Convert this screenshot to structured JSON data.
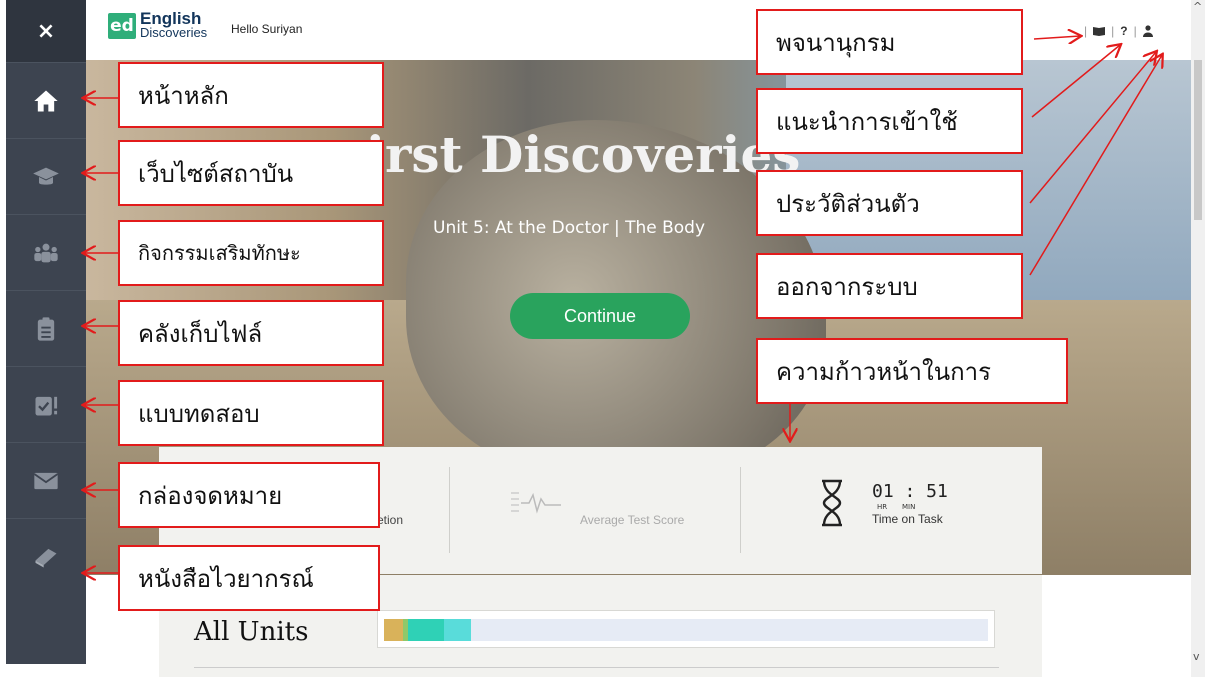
{
  "sidebar": {
    "close": "×",
    "items": [
      {
        "icon": "home-icon"
      },
      {
        "icon": "graduation-cap-icon"
      },
      {
        "icon": "users-icon"
      },
      {
        "icon": "clipboard-icon"
      },
      {
        "icon": "test-check-icon"
      },
      {
        "icon": "envelope-icon"
      },
      {
        "icon": "book-icon"
      }
    ]
  },
  "header": {
    "logo_badge": "ed",
    "logo_line1": "English",
    "logo_line2": "Discoveries",
    "greeting": "Hello Suriyan",
    "icons": [
      "dictionary-icon",
      "help-icon",
      "user-icon"
    ],
    "help_label": "?"
  },
  "hero": {
    "title": "irst Discoveries",
    "subtitle": "Unit 5: At the Doctor | The Body",
    "continue_label": "Continue"
  },
  "stats": {
    "completion_label": "etion",
    "average_test_score_label": "Average Test Score",
    "time_value": "01 : 51",
    "time_hr": "HR",
    "time_min": "MIN",
    "time_label": "Time on Task"
  },
  "units": {
    "title": "All Units",
    "progress_segments": [
      {
        "color": "#d9b25a",
        "fraction": 0.032
      },
      {
        "color": "#8fc96a",
        "fraction": 0.008
      },
      {
        "color": "#2fd1b6",
        "fraction": 0.06
      },
      {
        "color": "#59dcda",
        "fraction": 0.044
      }
    ]
  },
  "callouts": {
    "home": "หน้าหลัก",
    "institution": "เว็บไซต์สถาบัน",
    "activities": "กิจกรรมเสริมทักษะ",
    "portfolio": "คลังเก็บไฟล์",
    "tests": "แบบทดสอบ",
    "inbox": "กล่องจดหมาย",
    "grammar": "หนังสือไวยากรณ์",
    "dictionary": "พจนานุกรม",
    "help": "แนะนำการเข้าใช้",
    "profile": "ประวัติส่วนตัว",
    "logout": "ออกจากระบบ",
    "progress": "ความก้าวหน้าในการ"
  },
  "colors": {
    "sidebar": "#3d4450",
    "accent_green": "#29a35d",
    "callout_border": "#e21b1b"
  }
}
